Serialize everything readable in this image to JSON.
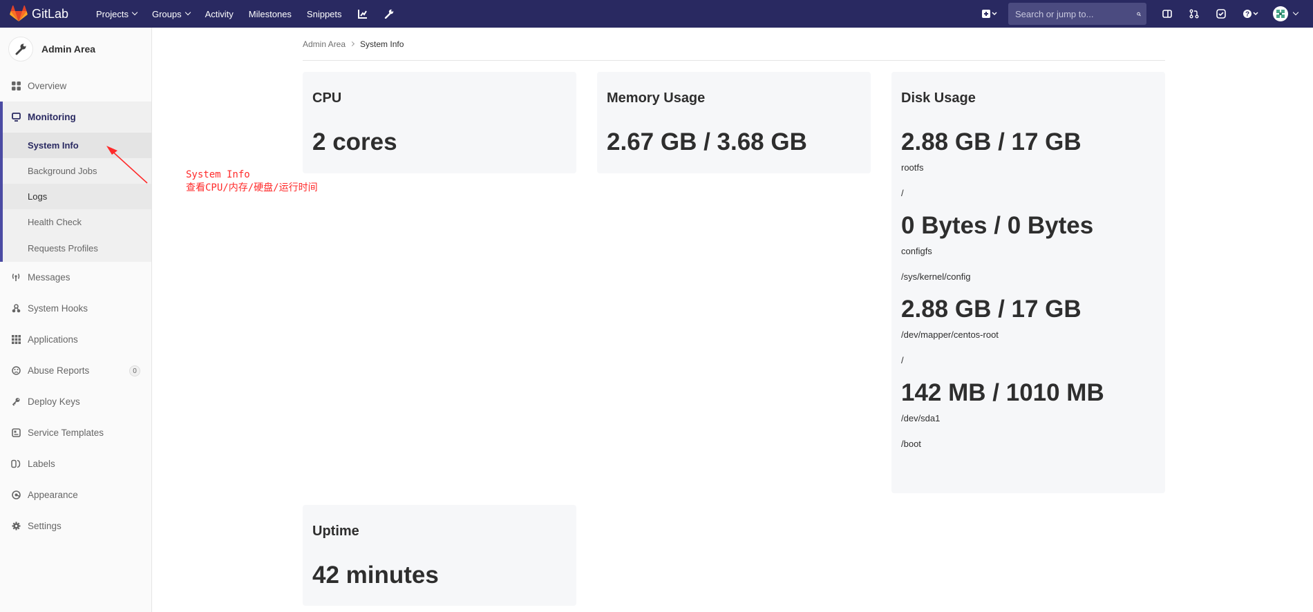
{
  "navbar": {
    "brand": "GitLab",
    "links": [
      {
        "label": "Projects",
        "dropdown": true
      },
      {
        "label": "Groups",
        "dropdown": true
      },
      {
        "label": "Activity",
        "dropdown": false
      },
      {
        "label": "Milestones",
        "dropdown": false
      },
      {
        "label": "Snippets",
        "dropdown": false
      }
    ],
    "search_placeholder": "Search or jump to...",
    "color": "#292961"
  },
  "sidebar": {
    "context_title": "Admin Area",
    "items_top": [
      {
        "label": "Overview",
        "icon": "overview-icon"
      }
    ],
    "monitoring": {
      "label": "Monitoring",
      "icon": "monitor-icon",
      "subitems": [
        {
          "label": "System Info",
          "active": true
        },
        {
          "label": "Background Jobs"
        },
        {
          "label": "Logs"
        },
        {
          "label": "Health Check"
        },
        {
          "label": "Requests Profiles"
        }
      ]
    },
    "items": [
      {
        "label": "Messages",
        "icon": "broadcast-icon"
      },
      {
        "label": "System Hooks",
        "icon": "hook-icon"
      },
      {
        "label": "Applications",
        "icon": "grid-icon"
      },
      {
        "label": "Abuse Reports",
        "icon": "face-icon",
        "badge": "0"
      },
      {
        "label": "Deploy Keys",
        "icon": "key-icon"
      },
      {
        "label": "Service Templates",
        "icon": "template-icon"
      },
      {
        "label": "Labels",
        "icon": "labels-icon"
      },
      {
        "label": "Appearance",
        "icon": "palette-icon"
      },
      {
        "label": "Settings",
        "icon": "gear-icon"
      }
    ]
  },
  "breadcrumb": {
    "parent": "Admin Area",
    "current": "System Info"
  },
  "cards": {
    "cpu": {
      "title": "CPU",
      "value": "2 cores"
    },
    "memory": {
      "title": "Memory Usage",
      "value": "2.67 GB / 3.68 GB"
    },
    "disk": {
      "title": "Disk Usage",
      "entries": [
        {
          "value": "2.88 GB / 17 GB",
          "device": "rootfs",
          "mount": "/"
        },
        {
          "value": "0 Bytes / 0 Bytes",
          "device": "configfs",
          "mount": "/sys/kernel/config"
        },
        {
          "value": "2.88 GB / 17 GB",
          "device": "/dev/mapper/centos-root",
          "mount": "/"
        },
        {
          "value": "142 MB / 1010 MB",
          "device": "/dev/sda1",
          "mount": "/boot"
        }
      ]
    },
    "uptime": {
      "title": "Uptime",
      "value": "42 minutes"
    }
  },
  "annotation": {
    "line1": "System Info",
    "line2": "查看CPU/内存/硬盘/运行时间",
    "color": "#ff2a2a"
  }
}
